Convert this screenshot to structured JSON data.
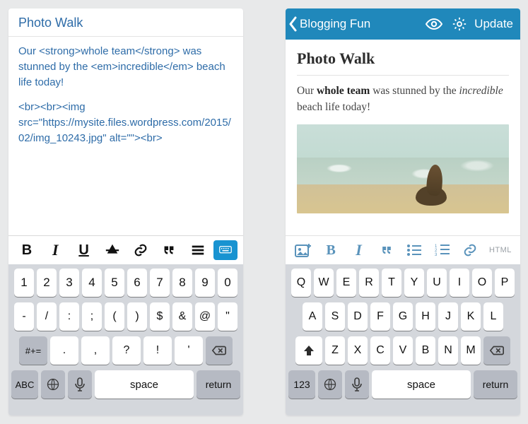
{
  "colors": {
    "accent": "#2088bb",
    "link_blue": "#2e6ca8"
  },
  "left": {
    "title": "Photo Walk",
    "source_line1": "Our <strong>whole team</strong> was stunned by the <em>incredible</em> beach life today!",
    "source_line2": "<br><br><img src=\"https://mysite.files.wordpress.com/2015/02/img_10243.jpg\" alt=\"\"><br>",
    "toolbar": {
      "bold_glyph": "B",
      "italic_glyph": "I"
    },
    "keyboard": {
      "row1": [
        "1",
        "2",
        "3",
        "4",
        "5",
        "6",
        "7",
        "8",
        "9",
        "0"
      ],
      "row2": [
        "-",
        "/",
        ":",
        ";",
        "(",
        ")",
        "$",
        "&",
        "@",
        "\""
      ],
      "row3_mod": "#+=",
      "row3": [
        ".",
        ",",
        "?",
        "!",
        "'"
      ],
      "bottom": {
        "abc": "ABC",
        "space": "space",
        "return": "return"
      }
    }
  },
  "right": {
    "navbar": {
      "back_label": "Blogging Fun",
      "update_label": "Update"
    },
    "title": "Photo Walk",
    "body_prefix": "Our ",
    "body_bold": "whole team",
    "body_mid": " was stunned by the ",
    "body_italic": "incredible",
    "body_suffix": " beach life today!",
    "image_alt": "seal on beach",
    "toolbar": {
      "bold_glyph": "B",
      "italic_glyph": "I",
      "html_label": "HTML"
    },
    "keyboard": {
      "row1": [
        "Q",
        "W",
        "E",
        "R",
        "T",
        "Y",
        "U",
        "I",
        "O",
        "P"
      ],
      "row2": [
        "A",
        "S",
        "D",
        "F",
        "G",
        "H",
        "J",
        "K",
        "L"
      ],
      "row3": [
        "Z",
        "X",
        "C",
        "V",
        "B",
        "N",
        "M"
      ],
      "bottom": {
        "num": "123",
        "space": "space",
        "return": "return"
      }
    }
  }
}
